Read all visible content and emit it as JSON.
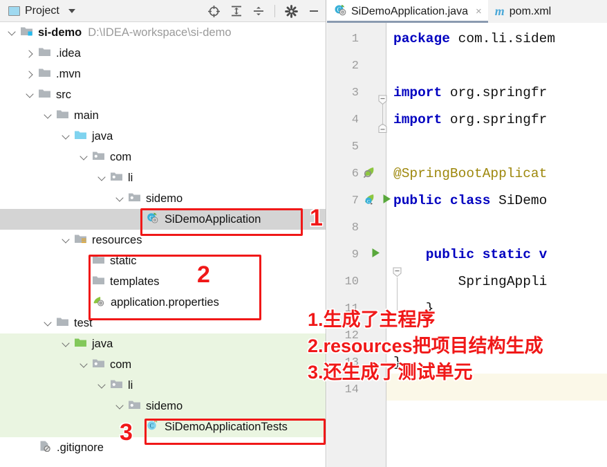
{
  "panel": {
    "title": "Project",
    "icons": {
      "project": "project-window-icon",
      "dropdown": "chevron-down-icon",
      "locate": "locate-target-icon",
      "expand": "expand-all-icon",
      "collapse": "collapse-all-icon",
      "settings": "gear-icon",
      "minimize": "minimize-icon"
    }
  },
  "tree": [
    {
      "label": "si-demo",
      "path": "D:\\IDEA-workspace\\si-demo",
      "icon": "module-folder-icon",
      "arrow": "down",
      "depth": 0,
      "bold": true
    },
    {
      "label": ".idea",
      "icon": "folder-icon",
      "arrow": "right",
      "depth": 1
    },
    {
      "label": ".mvn",
      "icon": "folder-icon",
      "arrow": "right",
      "depth": 1
    },
    {
      "label": "src",
      "icon": "folder-icon",
      "arrow": "down",
      "depth": 1
    },
    {
      "label": "main",
      "icon": "folder-icon",
      "arrow": "down",
      "depth": 2
    },
    {
      "label": "java",
      "icon": "source-root-folder-icon",
      "arrow": "down",
      "depth": 3
    },
    {
      "label": "com",
      "icon": "package-icon",
      "arrow": "down",
      "depth": 4
    },
    {
      "label": "li",
      "icon": "package-icon",
      "arrow": "down",
      "depth": 5
    },
    {
      "label": "sidemo",
      "icon": "package-icon",
      "arrow": "down",
      "depth": 6
    },
    {
      "label": "SiDemoApplication",
      "icon": "spring-class-icon",
      "arrow": "none",
      "depth": 7,
      "selected": true
    },
    {
      "label": "resources",
      "icon": "resource-root-folder-icon",
      "arrow": "down",
      "depth": 3
    },
    {
      "label": "static",
      "icon": "folder-icon",
      "arrow": "none",
      "depth": 4
    },
    {
      "label": "templates",
      "icon": "folder-icon",
      "arrow": "none",
      "depth": 4
    },
    {
      "label": "application.properties",
      "icon": "spring-properties-icon",
      "arrow": "none",
      "depth": 4
    },
    {
      "label": "test",
      "icon": "folder-icon",
      "arrow": "down",
      "depth": 2
    },
    {
      "label": "java",
      "icon": "test-root-folder-icon",
      "arrow": "down",
      "depth": 3,
      "testbg": true
    },
    {
      "label": "com",
      "icon": "package-icon",
      "arrow": "down",
      "depth": 4,
      "testbg": true
    },
    {
      "label": "li",
      "icon": "package-icon",
      "arrow": "down",
      "depth": 5,
      "testbg": true
    },
    {
      "label": "sidemo",
      "icon": "package-icon",
      "arrow": "down",
      "depth": 6,
      "testbg": true
    },
    {
      "label": "SiDemoApplicationTests",
      "icon": "test-class-icon",
      "arrow": "none",
      "depth": 7,
      "testbg": true
    },
    {
      "label": ".gitignore",
      "icon": "ignored-file-icon",
      "arrow": "none",
      "depth": 1
    }
  ],
  "editor": {
    "tabs": [
      {
        "label": "SiDemoApplication.java",
        "icon": "spring-class-icon",
        "active": true,
        "close": "×"
      },
      {
        "label": "pom.xml",
        "icon": "maven-icon",
        "active": false
      }
    ],
    "line_numbers": [
      "1",
      "2",
      "3",
      "4",
      "5",
      "6",
      "7",
      "8",
      "9",
      "10",
      "11",
      "12",
      "13",
      "14"
    ],
    "lines": [
      {
        "n": "1",
        "segments": [
          {
            "t": "package ",
            "c": "kw"
          },
          {
            "t": "com.li.sidem",
            "c": "pln"
          }
        ]
      },
      {
        "n": "2",
        "segments": []
      },
      {
        "n": "3",
        "segments": [
          {
            "t": "import ",
            "c": "kw"
          },
          {
            "t": "org.springfr",
            "c": "pln"
          }
        ]
      },
      {
        "n": "4",
        "segments": [
          {
            "t": "import ",
            "c": "kw"
          },
          {
            "t": "org.springfr",
            "c": "pln"
          }
        ]
      },
      {
        "n": "5",
        "segments": []
      },
      {
        "n": "6",
        "segments": [
          {
            "t": "@SpringBootApplicat",
            "c": "ann"
          }
        ]
      },
      {
        "n": "7",
        "segments": [
          {
            "t": "public class ",
            "c": "kw"
          },
          {
            "t": "SiDemo",
            "c": "pln"
          }
        ]
      },
      {
        "n": "8",
        "segments": []
      },
      {
        "n": "9",
        "segments": [
          {
            "t": "    public static v",
            "c": "kw"
          }
        ]
      },
      {
        "n": "10",
        "segments": [
          {
            "t": "        SpringAppli",
            "c": "pln"
          }
        ]
      },
      {
        "n": "11",
        "segments": [
          {
            "t": "    }",
            "c": "pln"
          }
        ]
      },
      {
        "n": "12",
        "segments": []
      },
      {
        "n": "13",
        "segments": [
          {
            "t": "}",
            "c": "pln"
          }
        ]
      },
      {
        "n": "14",
        "segments": []
      }
    ],
    "gutter_icons": [
      {
        "line": 6,
        "name": "spring-bean-search-icon"
      },
      {
        "line": 7,
        "name": "spring-boot-config-icon"
      },
      {
        "line": 7,
        "name": "run-application-icon"
      },
      {
        "line": 9,
        "name": "run-main-method-icon"
      }
    ]
  },
  "annotations": {
    "markers": [
      {
        "id": "1",
        "label": "1"
      },
      {
        "id": "2",
        "label": "2"
      },
      {
        "id": "3",
        "label": "3"
      }
    ],
    "notes": [
      "1.生成了主程序",
      "2.resources把项目结构生成",
      "3.还生成了测试单元"
    ]
  },
  "colors": {
    "annotation_red": "#f01818",
    "selection_gray": "#d4d4d4",
    "test_green_bg": "#eaf5e1",
    "line_highlight": "#fbf8e8",
    "keyword_blue": "#0000c0",
    "annotation_yellow": "#9e880d"
  }
}
